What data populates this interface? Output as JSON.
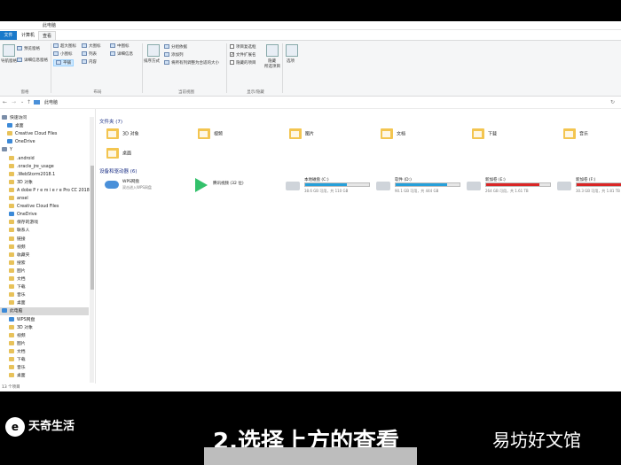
{
  "window": {
    "title": "此电脑"
  },
  "tabs": {
    "file": "文件",
    "computer": "计算机",
    "view": "查看"
  },
  "ribbon": {
    "pane_group": "窗格",
    "pane_nav": "导航窗格",
    "pane_preview": "预览窗格",
    "pane_details": "详细信息窗格",
    "layout_group": "布局",
    "layout": [
      "超大图标",
      "大图标",
      "中图标",
      "小图标",
      "列表",
      "详细信息",
      "平铺",
      "内容"
    ],
    "view_group": "当前视图",
    "sort": "排序方式",
    "groupby": "分组依据",
    "addcol": "添加列",
    "fitcol": "将所有列调整为合适的大小",
    "show_group": "显示/隐藏",
    "show_checkbox": "项目复选框",
    "show_ext": "文件扩展名",
    "show_hidden": "隐藏的项目",
    "hide_sel": "隐藏",
    "hide_sel2": "所选项目",
    "options": "选项"
  },
  "address": {
    "path": "此电脑"
  },
  "nav": [
    {
      "label": "快速访问",
      "icon": "star-icon",
      "sel": false
    },
    {
      "label": "桌面",
      "icon": "desktop-icon",
      "sel": false
    },
    {
      "label": "Creative Cloud Files",
      "icon": "folder-icon",
      "sel": false
    },
    {
      "label": "OneDrive",
      "icon": "cloud-icon",
      "sel": false
    },
    {
      "label": "Y",
      "icon": "user-icon",
      "sel": false
    },
    {
      "label": ".android",
      "icon": "folder-icon",
      "sel": false
    },
    {
      "label": ".oracle_jre_usage",
      "icon": "folder-icon",
      "sel": false
    },
    {
      "label": ".WebStorm2018.1",
      "icon": "folder-icon",
      "sel": false
    },
    {
      "label": "3D 对象",
      "icon": "folder-icon",
      "sel": false
    },
    {
      "label": "A dobe P r e m i e r e Pro CC 2018",
      "icon": "folder-icon",
      "sel": false
    },
    {
      "label": "ansel",
      "icon": "folder-icon",
      "sel": false
    },
    {
      "label": "Creative Cloud Files",
      "icon": "folder-icon",
      "sel": false
    },
    {
      "label": "OneDrive",
      "icon": "cloud-icon",
      "sel": false
    },
    {
      "label": "保存的游戏",
      "icon": "folder-icon",
      "sel": false
    },
    {
      "label": "联系人",
      "icon": "folder-icon",
      "sel": false
    },
    {
      "label": "链接",
      "icon": "folder-icon",
      "sel": false
    },
    {
      "label": "视频",
      "icon": "folder-icon",
      "sel": false
    },
    {
      "label": "收藏夹",
      "icon": "folder-icon",
      "sel": false
    },
    {
      "label": "搜索",
      "icon": "folder-icon",
      "sel": false
    },
    {
      "label": "图片",
      "icon": "folder-icon",
      "sel": false
    },
    {
      "label": "文档",
      "icon": "folder-icon",
      "sel": false
    },
    {
      "label": "下载",
      "icon": "folder-icon",
      "sel": false
    },
    {
      "label": "音乐",
      "icon": "folder-icon",
      "sel": false
    },
    {
      "label": "桌面",
      "icon": "folder-icon",
      "sel": false
    },
    {
      "label": "此电脑",
      "icon": "computer-icon",
      "sel": true
    },
    {
      "label": "WPS网盘",
      "icon": "cloud-icon",
      "sel": false
    },
    {
      "label": "3D 对象",
      "icon": "folder-icon",
      "sel": false
    },
    {
      "label": "视频",
      "icon": "folder-icon",
      "sel": false
    },
    {
      "label": "图片",
      "icon": "folder-icon",
      "sel": false
    },
    {
      "label": "文档",
      "icon": "folder-icon",
      "sel": false
    },
    {
      "label": "下载",
      "icon": "folder-icon",
      "sel": false
    },
    {
      "label": "音乐",
      "icon": "folder-icon",
      "sel": false
    },
    {
      "label": "桌面",
      "icon": "folder-icon",
      "sel": false
    }
  ],
  "folders_section": "文件夹 (7)",
  "folders": [
    "3D 对象",
    "视频",
    "图片",
    "文档",
    "下载",
    "音乐",
    "桌面"
  ],
  "devices_section": "设备和驱动器 (6)",
  "devices": [
    {
      "name": "WPS网盘",
      "sub": "双击进入WPS网盘",
      "kind": "cloud"
    },
    {
      "name": "腾讯视频 (32 位)",
      "sub": "",
      "kind": "app"
    }
  ],
  "drives": [
    {
      "name": "本地磁盘 (C:)",
      "sub": "38.6 GB 可用，共 110 GB",
      "fill": 0.65,
      "color": "#26a0da"
    },
    {
      "name": "软件 (D:)",
      "sub": "90.1 GB 可用，共 444 GB",
      "fill": 0.8,
      "color": "#26a0da"
    },
    {
      "name": "新加卷 (E:)",
      "sub": "264 GB 可用，共 1.61 TB",
      "fill": 0.84,
      "color": "#da2626"
    },
    {
      "name": "新加卷 (F:)",
      "sub": "30.3 GB 可用，共 1.81 TB",
      "fill": 0.98,
      "color": "#da2626"
    }
  ],
  "status": "13 个项目",
  "overlay": {
    "logo": "天奇生活",
    "logo_mark": "e",
    "subtitle": "2.选择上方的查看",
    "watermark": "易坊好文馆"
  }
}
